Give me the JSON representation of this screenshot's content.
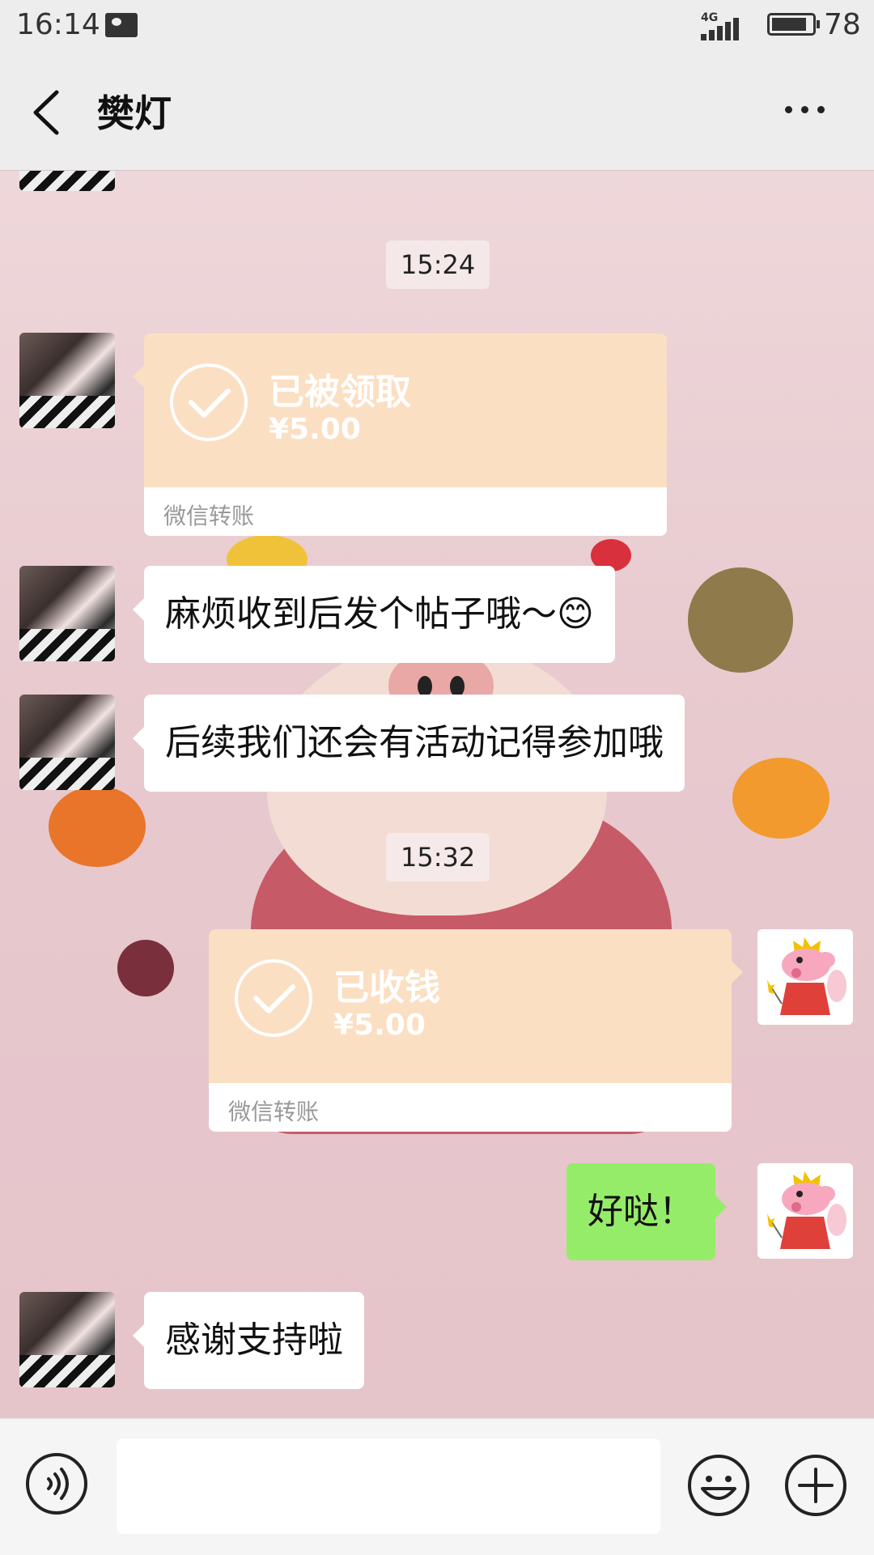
{
  "status_bar": {
    "time": "16:14",
    "network": "4G",
    "battery": "78"
  },
  "header": {
    "title": "樊灯"
  },
  "messages": {
    "time_1": "15:24",
    "transfer_1": {
      "status": "已被领取",
      "amount": "¥5.00",
      "label": "微信转账"
    },
    "text_1": "麻烦收到后发个帖子哦～😊",
    "text_2": "后续我们还会有活动记得参加哦",
    "time_2": "15:32",
    "transfer_2": {
      "status": "已收钱",
      "amount": "¥5.00",
      "label": "微信转账"
    },
    "text_3": "好哒！",
    "text_4": "感谢支持啦"
  },
  "input": {
    "value": "",
    "placeholder": ""
  },
  "icons": {
    "back": "chevron-left-icon",
    "more": "more-dots-icon",
    "voice": "voice-icon",
    "emoji": "emoji-icon",
    "plus": "plus-icon",
    "check": "check-icon"
  },
  "colors": {
    "header_bg": "#ededed",
    "transfer_orange": "#fbdfc3",
    "sent_bubble": "#95ec69",
    "received_bubble": "#ffffff"
  }
}
